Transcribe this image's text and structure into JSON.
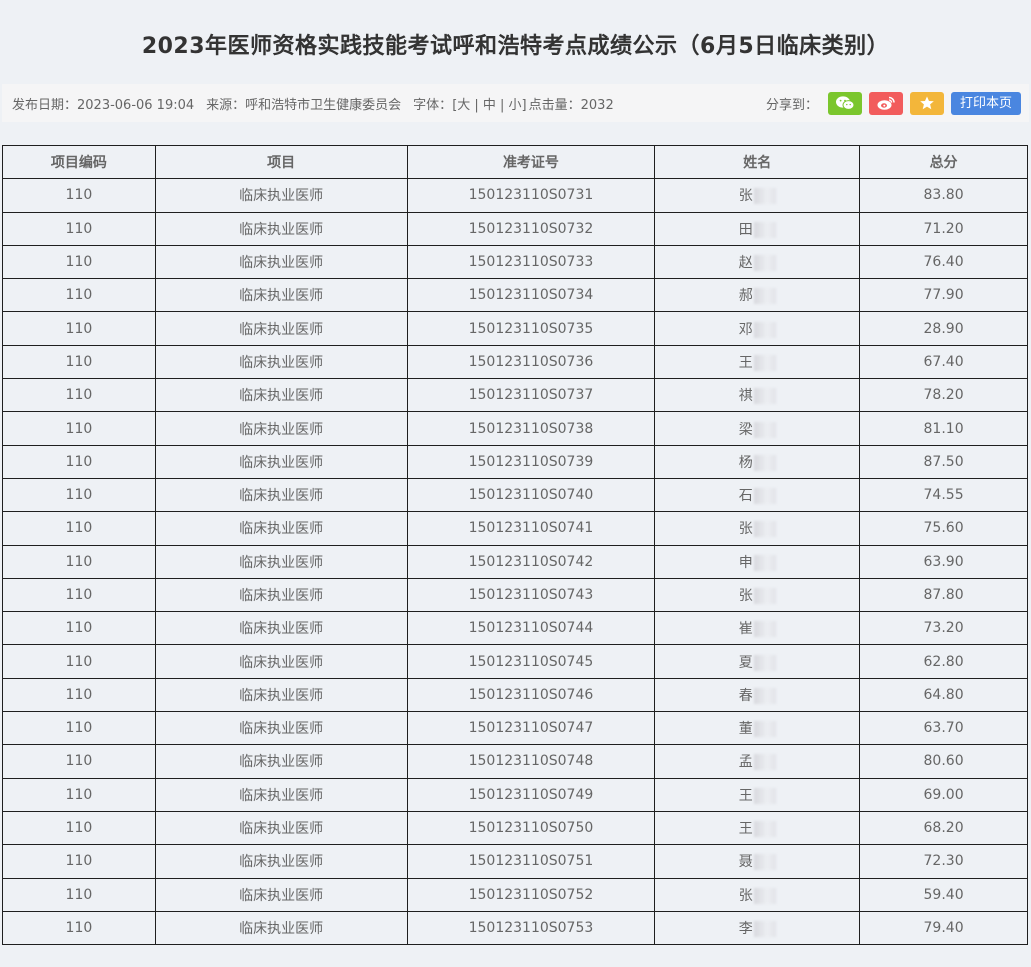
{
  "title": "2023年医师资格实践技能考试呼和浩特考点成绩公示（6月5日临床类别）",
  "meta": {
    "publish": "发布日期：2023-06-06 19:04",
    "source": "来源：呼和浩特市卫生健康委员会",
    "font_label": "字体：",
    "font_options": "[大 | 中 | 小]",
    "clicks": "点击量：2032",
    "share_label": "分享到：",
    "print_label": "打印本页"
  },
  "share_icons": [
    "wechat-icon",
    "weibo-icon",
    "star-icon"
  ],
  "share_colors": {
    "wechat": "#7bc62d",
    "weibo": "#f25c5c",
    "fav": "#f3b63a",
    "print": "#4a86e0"
  },
  "table": {
    "headers": [
      "项目编码",
      "项目",
      "准考证号",
      "姓名",
      "总分"
    ],
    "rows": [
      {
        "code": "110",
        "item": "临床执业医师",
        "id": "150123110S0731",
        "name": "张",
        "score": "83.80"
      },
      {
        "code": "110",
        "item": "临床执业医师",
        "id": "150123110S0732",
        "name": "田",
        "score": "71.20"
      },
      {
        "code": "110",
        "item": "临床执业医师",
        "id": "150123110S0733",
        "name": "赵",
        "score": "76.40"
      },
      {
        "code": "110",
        "item": "临床执业医师",
        "id": "150123110S0734",
        "name": "郝",
        "score": "77.90"
      },
      {
        "code": "110",
        "item": "临床执业医师",
        "id": "150123110S0735",
        "name": "邓",
        "score": "28.90"
      },
      {
        "code": "110",
        "item": "临床执业医师",
        "id": "150123110S0736",
        "name": "王",
        "score": "67.40"
      },
      {
        "code": "110",
        "item": "临床执业医师",
        "id": "150123110S0737",
        "name": "祺",
        "score": "78.20"
      },
      {
        "code": "110",
        "item": "临床执业医师",
        "id": "150123110S0738",
        "name": "梁",
        "score": "81.10"
      },
      {
        "code": "110",
        "item": "临床执业医师",
        "id": "150123110S0739",
        "name": "杨",
        "score": "87.50"
      },
      {
        "code": "110",
        "item": "临床执业医师",
        "id": "150123110S0740",
        "name": "石",
        "score": "74.55"
      },
      {
        "code": "110",
        "item": "临床执业医师",
        "id": "150123110S0741",
        "name": "张",
        "score": "75.60"
      },
      {
        "code": "110",
        "item": "临床执业医师",
        "id": "150123110S0742",
        "name": "申",
        "score": "63.90"
      },
      {
        "code": "110",
        "item": "临床执业医师",
        "id": "150123110S0743",
        "name": "张",
        "score": "87.80"
      },
      {
        "code": "110",
        "item": "临床执业医师",
        "id": "150123110S0744",
        "name": "崔",
        "score": "73.20"
      },
      {
        "code": "110",
        "item": "临床执业医师",
        "id": "150123110S0745",
        "name": "夏",
        "score": "62.80"
      },
      {
        "code": "110",
        "item": "临床执业医师",
        "id": "150123110S0746",
        "name": "春",
        "score": "64.80"
      },
      {
        "code": "110",
        "item": "临床执业医师",
        "id": "150123110S0747",
        "name": "董",
        "score": "63.70"
      },
      {
        "code": "110",
        "item": "临床执业医师",
        "id": "150123110S0748",
        "name": "孟",
        "score": "80.60"
      },
      {
        "code": "110",
        "item": "临床执业医师",
        "id": "150123110S0749",
        "name": "王",
        "score": "69.00"
      },
      {
        "code": "110",
        "item": "临床执业医师",
        "id": "150123110S0750",
        "name": "王",
        "score": "68.20"
      },
      {
        "code": "110",
        "item": "临床执业医师",
        "id": "150123110S0751",
        "name": "聂",
        "score": "72.30"
      },
      {
        "code": "110",
        "item": "临床执业医师",
        "id": "150123110S0752",
        "name": "张",
        "score": "59.40"
      },
      {
        "code": "110",
        "item": "临床执业医师",
        "id": "150123110S0753",
        "name": "李",
        "score": "79.40"
      }
    ]
  }
}
